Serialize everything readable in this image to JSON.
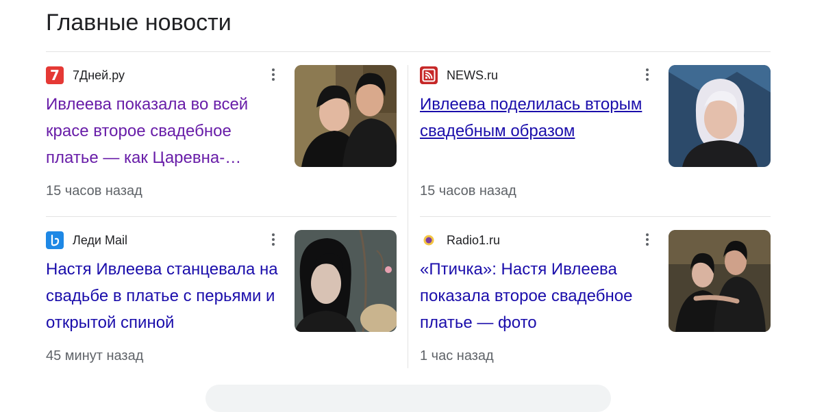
{
  "section": {
    "title": "Главные новости"
  },
  "articles": [
    {
      "source": "7Дней.ру",
      "favicon_text": "7",
      "favicon_bg": "#e53935",
      "headline": "Ивлеева показала во всей красе второе свадебное платье — как Царевна-…",
      "time": "15 часов назад",
      "headline_color": "#681da8"
    },
    {
      "source": "NEWS.ru",
      "favicon_text": "",
      "favicon_bg": "#c62828",
      "headline": "Ивлеева поделилась вторым свадебным образом",
      "time": "15 часов назад",
      "headline_color": "#1a0dab"
    },
    {
      "source": "Леди Mail",
      "favicon_text": "",
      "favicon_bg": "#1e88e5",
      "headline": "Настя Ивлеева станцевала на свадьбе в платье с перьями и открытой спиной",
      "time": "45 минут назад",
      "headline_color": "#1a0dab"
    },
    {
      "source": "Radio1.ru",
      "favicon_text": "",
      "favicon_bg": "#ffffff",
      "headline": "«Птичка»: Настя Ивлеева показала второе свадебное платье — фото",
      "time": "1 час назад",
      "headline_color": "#1a0dab"
    }
  ]
}
